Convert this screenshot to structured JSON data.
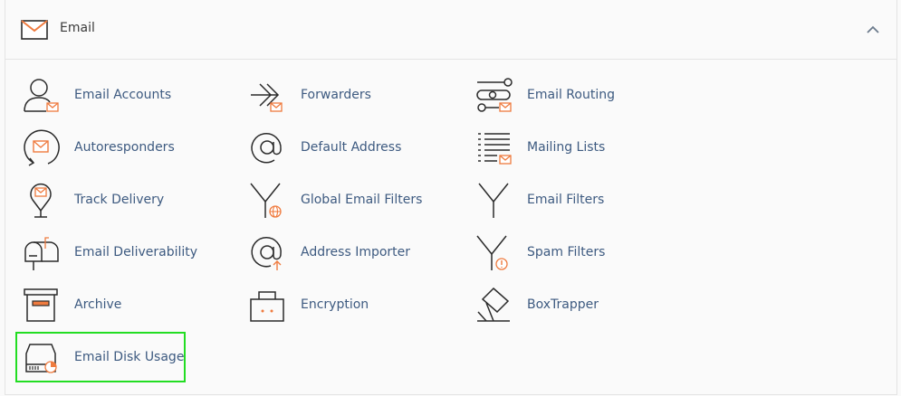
{
  "section": {
    "title": "Email",
    "icon": "envelope-icon",
    "collapse_icon": "chevron-up-icon"
  },
  "colors": {
    "label": "#3d5a80",
    "accent": "#ef7b3f",
    "icon_stroke": "#2b2b2b",
    "highlight": "#22dd22"
  },
  "items": [
    {
      "label": "Email Accounts",
      "icon": "email-accounts-icon"
    },
    {
      "label": "Forwarders",
      "icon": "forwarders-icon"
    },
    {
      "label": "Email Routing",
      "icon": "email-routing-icon"
    },
    {
      "label": "Autoresponders",
      "icon": "autoresponders-icon"
    },
    {
      "label": "Default Address",
      "icon": "default-address-icon"
    },
    {
      "label": "Mailing Lists",
      "icon": "mailing-lists-icon"
    },
    {
      "label": "Track Delivery",
      "icon": "track-delivery-icon"
    },
    {
      "label": "Global Email Filters",
      "icon": "global-email-filters-icon"
    },
    {
      "label": "Email Filters",
      "icon": "email-filters-icon"
    },
    {
      "label": "Email Deliverability",
      "icon": "email-deliverability-icon"
    },
    {
      "label": "Address Importer",
      "icon": "address-importer-icon"
    },
    {
      "label": "Spam Filters",
      "icon": "spam-filters-icon"
    },
    {
      "label": "Archive",
      "icon": "archive-icon"
    },
    {
      "label": "Encryption",
      "icon": "encryption-icon"
    },
    {
      "label": "BoxTrapper",
      "icon": "boxtrapper-icon"
    },
    {
      "label": "Email Disk Usage",
      "icon": "email-disk-usage-icon"
    }
  ]
}
